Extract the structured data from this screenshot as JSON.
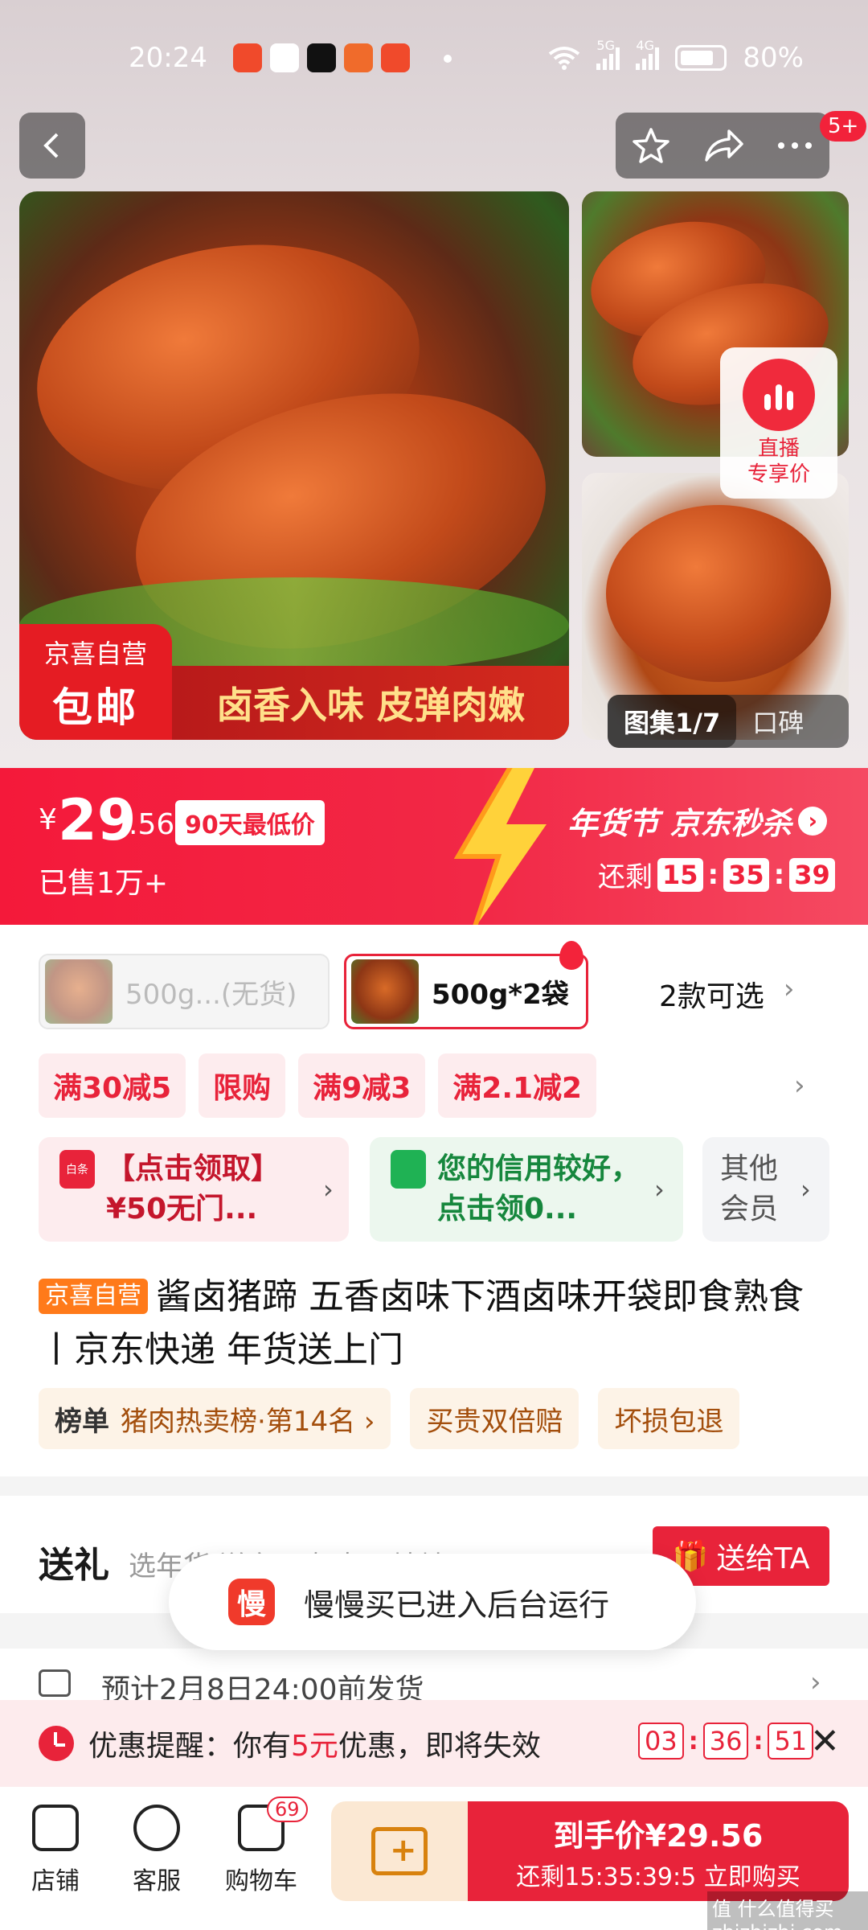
{
  "status_bar": {
    "time": "20:24",
    "network_5g": "5G",
    "network_4g": "4G",
    "battery": "80%"
  },
  "topbar": {
    "back_icon": "chevron-left",
    "favorite_icon": "star",
    "share_icon": "share-arrow",
    "more_icon": "ellipsis",
    "badge": "5+"
  },
  "gallery": {
    "tag_top": "京喜自营",
    "tag_bottom": "包邮",
    "slogan": "卤香入味 皮弹肉嫩",
    "live_top": "直播",
    "live_bottom": "专享价",
    "counter": "图集1/7",
    "review_tab": "口碑"
  },
  "price_banner": {
    "currency": "¥",
    "price_int": "29",
    "price_dec": ".56",
    "low_badge": "90天最低价",
    "sold": "已售1万+",
    "campaign": "年货节 京东秒杀",
    "remain_label": "还剩",
    "h": "15",
    "m": "35",
    "s": "39",
    "colors": {
      "bg": "#f4193a",
      "accent": "#ffffff"
    }
  },
  "variants": {
    "items": [
      {
        "label": "500g...(无货)",
        "available": false
      },
      {
        "label": "500g*2袋",
        "available": true
      }
    ],
    "more": "2款可选"
  },
  "promos": [
    "满30减5",
    "限购",
    "满9减3",
    "满2.1减2"
  ],
  "coupons": [
    {
      "text": "【点击领取】¥50无门...",
      "icon": "coupon-icon"
    },
    {
      "text": "您的信用较好，点击领0...",
      "icon": "shield-check-icon"
    },
    {
      "text": "其他会员",
      "icon": ""
    }
  ],
  "product": {
    "tag": "京喜自营",
    "title": "酱卤猪蹄 五香卤味下酒卤味开袋即食熟食丨京东快递 年货送上门"
  },
  "ranks": [
    {
      "label": "榜单",
      "value": "猪肉热卖榜·第14名 ›"
    },
    {
      "label": "",
      "value": "买贵双倍赔"
    },
    {
      "label": "",
      "value": "坏损包退"
    }
  ],
  "gift": {
    "title": "送礼",
    "subtitle": "选年货 送亲朋 好友写地址",
    "button": "送给TA"
  },
  "toast": {
    "icon_text": "慢",
    "text": "慢慢买已进入后台运行"
  },
  "shipping": {
    "text": "预计2月8日24:00前发货"
  },
  "reminder": {
    "prefix": "优惠提醒：你有",
    "amount": "5元",
    "suffix": "优惠，即将失效",
    "h": "03",
    "m": "36",
    "s": "51"
  },
  "bottom_bar": {
    "store": "店铺",
    "service": "客服",
    "cart": "购物车",
    "cart_count": "69",
    "buy_title": "到手价¥29.56",
    "buy_sub": "还剩15:35:39:5 立即购买",
    "watermark": "值 什么值得买 zhizhizhi.com"
  }
}
